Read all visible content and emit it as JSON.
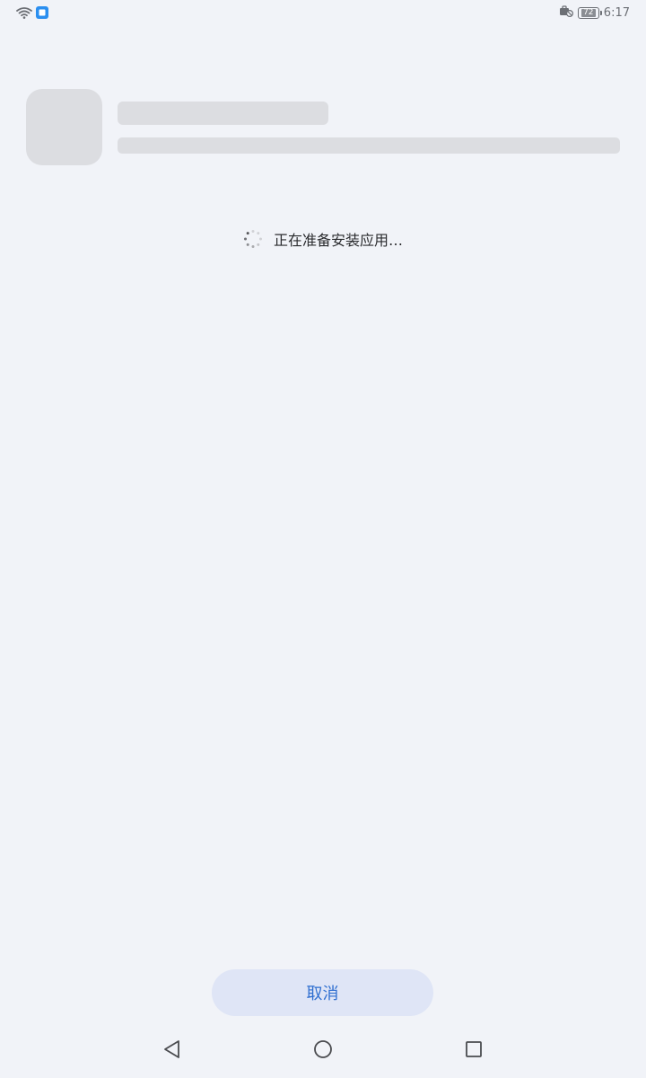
{
  "status_bar": {
    "time": "6:17",
    "battery_level": "72",
    "icons_left": [
      "wifi-icon",
      "notification-app-icon"
    ],
    "icons_right": [
      "briefcase-alarm-icon",
      "battery-icon"
    ]
  },
  "install": {
    "loading_text": "正在准备安装应用…"
  },
  "actions": {
    "cancel_label": "取消"
  },
  "nav_bar": {
    "items": [
      "back-icon",
      "home-icon",
      "recents-icon"
    ]
  },
  "colors": {
    "background": "#f1f3f8",
    "skeleton": "#dcdde1",
    "button_bg": "#dfe5f6",
    "accent": "#2f6fd0"
  }
}
